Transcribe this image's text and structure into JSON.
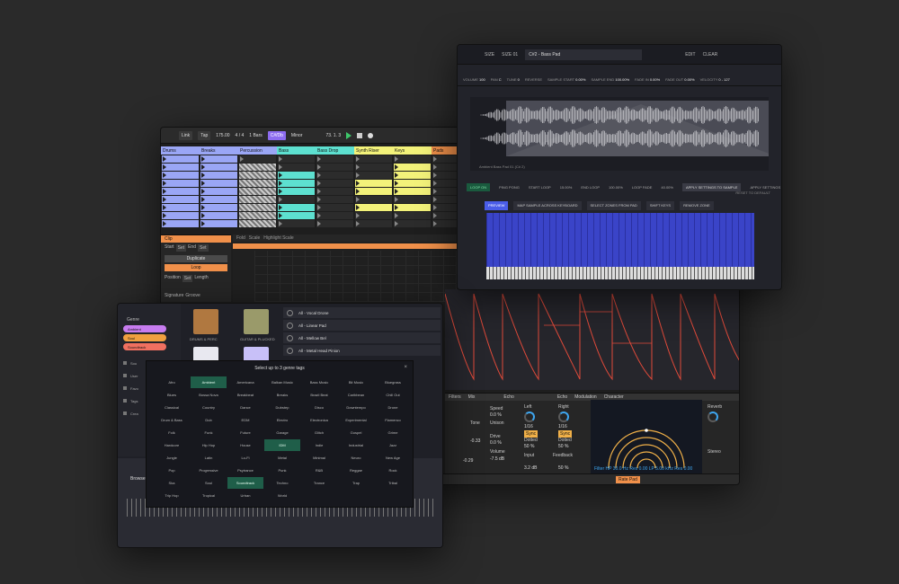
{
  "session": {
    "toolbar": {
      "link": "Link",
      "tap": "Tap",
      "tempo": "175.00",
      "signature": "4 / 4",
      "quant": "1 Bars",
      "key": "C#/Db",
      "scale": "Minor",
      "position": "73. 1. 3"
    },
    "tracks": [
      {
        "name": "Drums",
        "color": "#9aa6f5"
      },
      {
        "name": "Breaks",
        "color": "#9aa6f5"
      },
      {
        "name": "Percussion",
        "color": "#9aa6f5"
      },
      {
        "name": "Bass",
        "color": "#5de0d0"
      },
      {
        "name": "Bass Drop",
        "color": "#5de0d0"
      },
      {
        "name": "Synth Riser",
        "color": "#f3f27a"
      },
      {
        "name": "Keys",
        "color": "#f3f27a"
      },
      {
        "name": "Pads",
        "color": "#f0904a"
      }
    ],
    "clip": {
      "title": "Clip",
      "start": "Start",
      "set": "Set",
      "end": "End",
      "duplicate": "Duplicate",
      "loop": "Loop",
      "position": "Position",
      "length": "Length",
      "signature": "Signature",
      "groove": "Groove"
    },
    "editor_tabs": [
      "Fold",
      "Scale",
      "Highlight Scale"
    ],
    "devices": {
      "filter_title": "Filters",
      "mix": "Mix",
      "echo_title": "Echo",
      "echo_tabs": [
        "Echo",
        "Modulation",
        "Character"
      ],
      "left": "Left",
      "right": "Right",
      "sync": "Sync",
      "dotted": "Dotted",
      "input": "Input",
      "feedback": "Feedback",
      "reverb": "Reverb",
      "stereo": "Stereo",
      "speed": "Speed",
      "unison": "Unison",
      "drive": "Drive",
      "volume": "Volume",
      "tone": "Tone",
      "echo_readout": "Filter HP 30.0 Hz  Res 0.00  LP 5.00 kHz  Res 0.00",
      "rate_pad": "Rate Pad",
      "values": {
        "left": "1/16",
        "right": "1/16",
        "dotted_l": "50 %",
        "dotted_r": "50 %",
        "input": "3.2 dB",
        "feedback": "50 %",
        "speed": "0.0 %",
        "drive": "0.0 %",
        "volume": "-7.5 dB",
        "tone": "-0.29",
        "tone2": "-0.33"
      }
    }
  },
  "sampler": {
    "toolbar": [
      "SIZE",
      "SIZE 01"
    ],
    "sample_name": "C#2 - Bass Pad",
    "right_buttons": [
      "EDIT",
      "CLEAR"
    ],
    "params": [
      {
        "label": "VOLUME",
        "value": "100"
      },
      {
        "label": "PAN",
        "value": "C"
      },
      {
        "label": "TUNE",
        "value": "0"
      },
      {
        "label": "REVERSE",
        "value": ""
      },
      {
        "label": "SAMPLE START",
        "value": "0.00%"
      },
      {
        "label": "SAMPLE END",
        "value": "100.00%"
      },
      {
        "label": "FADE IN",
        "value": "0.00%"
      },
      {
        "label": "FADE OUT",
        "value": "0.00%"
      },
      {
        "label": "VELOCITY",
        "value": "0 - 127"
      }
    ],
    "wave_caption": "Ambient Bass Pad 01 (C# 2)",
    "controls": [
      {
        "label": "LOOP ON",
        "style": "loop"
      },
      {
        "label": "PING PONG",
        "style": ""
      },
      {
        "label": "START LOOP",
        "style": ""
      },
      {
        "label": "15.00%",
        "style": ""
      },
      {
        "label": "END LOOP",
        "style": ""
      },
      {
        "label": "100.00%",
        "style": ""
      },
      {
        "label": "LOOP FADE",
        "style": ""
      },
      {
        "label": "40.00%",
        "style": ""
      },
      {
        "label": "APPLY SETTINGS TO SAMPLE",
        "style": "apply"
      },
      {
        "label": "APPLY SETTINGS TO GROUP",
        "style": ""
      }
    ],
    "reset": "RESET TO DEFAULT",
    "slice_buttons": [
      {
        "label": "PREVIEW",
        "active": true
      },
      {
        "label": "MAP SAMPLE ACROSS KEYBOARD",
        "active": false
      },
      {
        "label": "SELECT ZONES FROM PAD",
        "active": false
      },
      {
        "label": "SHIFT KEYS",
        "active": false
      },
      {
        "label": "REMOVE ZONE",
        "active": false
      }
    ]
  },
  "browser": {
    "genre_label": "Genre",
    "genre_pills": [
      {
        "name": "Ambient",
        "color": "#c77cf0"
      },
      {
        "name": "Soul",
        "color": "#f0a040"
      },
      {
        "name": "Soundtrack",
        "color": "#f07060"
      }
    ],
    "sidebar": [
      "Sou",
      "User",
      "Favo",
      "Tags",
      "Crea"
    ],
    "thumbs": [
      {
        "caption": "DRUMS & PERC",
        "color": "#b07840"
      },
      {
        "caption": "GUITAR & PLUCKED",
        "color": "#9a9a6a"
      },
      {
        "caption": "",
        "color": "#e8e8f0"
      },
      {
        "caption": "",
        "color": "#c8c0f8"
      }
    ],
    "presets": [
      "All - Vocal Drone",
      "All - Linear Pad",
      "All - Mellow Bel",
      "All - Metal Head Pinion"
    ],
    "browse_tab": "Browse",
    "dialog": {
      "title": "Select up to 3 genre tags",
      "close": "×",
      "genres": [
        "Afro",
        "Ambient",
        "Americana",
        "Balkan Music",
        "Bass Music",
        "Bit Music",
        "Bluegrass",
        "Blues",
        "Bossa Nova",
        "Breakbeat",
        "Breaks",
        "Brazil Beat",
        "Caribbean",
        "Chill Out",
        "Classical",
        "Country",
        "Dance",
        "Dubstep",
        "Disco",
        "Downtempo",
        "Drone",
        "Drum & Bass",
        "Dub",
        "EDM",
        "Electro",
        "Electronica",
        "Experimental",
        "Flamenco",
        "Folk",
        "Funk",
        "Future",
        "Garage",
        "Glitch",
        "Gospel",
        "Grime",
        "Hardcore",
        "Hip Hop",
        "House",
        "IDM",
        "Indie",
        "Industrial",
        "Jazz",
        "Jungle",
        "Latin",
        "Lo-Fi",
        "Metal",
        "Minimal",
        "Neuro",
        "New Age",
        "Pop",
        "Progressive",
        "Psytrance",
        "Punk",
        "R&B",
        "Reggae",
        "Rock",
        "Ska",
        "Soul",
        "Soundtrack",
        "Techno",
        "Trance",
        "Trap",
        "Tribal",
        "Trip Hop",
        "Tropical",
        "Urban",
        "World"
      ],
      "selected": [
        "Ambient",
        "IDM",
        "Soundtrack"
      ]
    }
  }
}
